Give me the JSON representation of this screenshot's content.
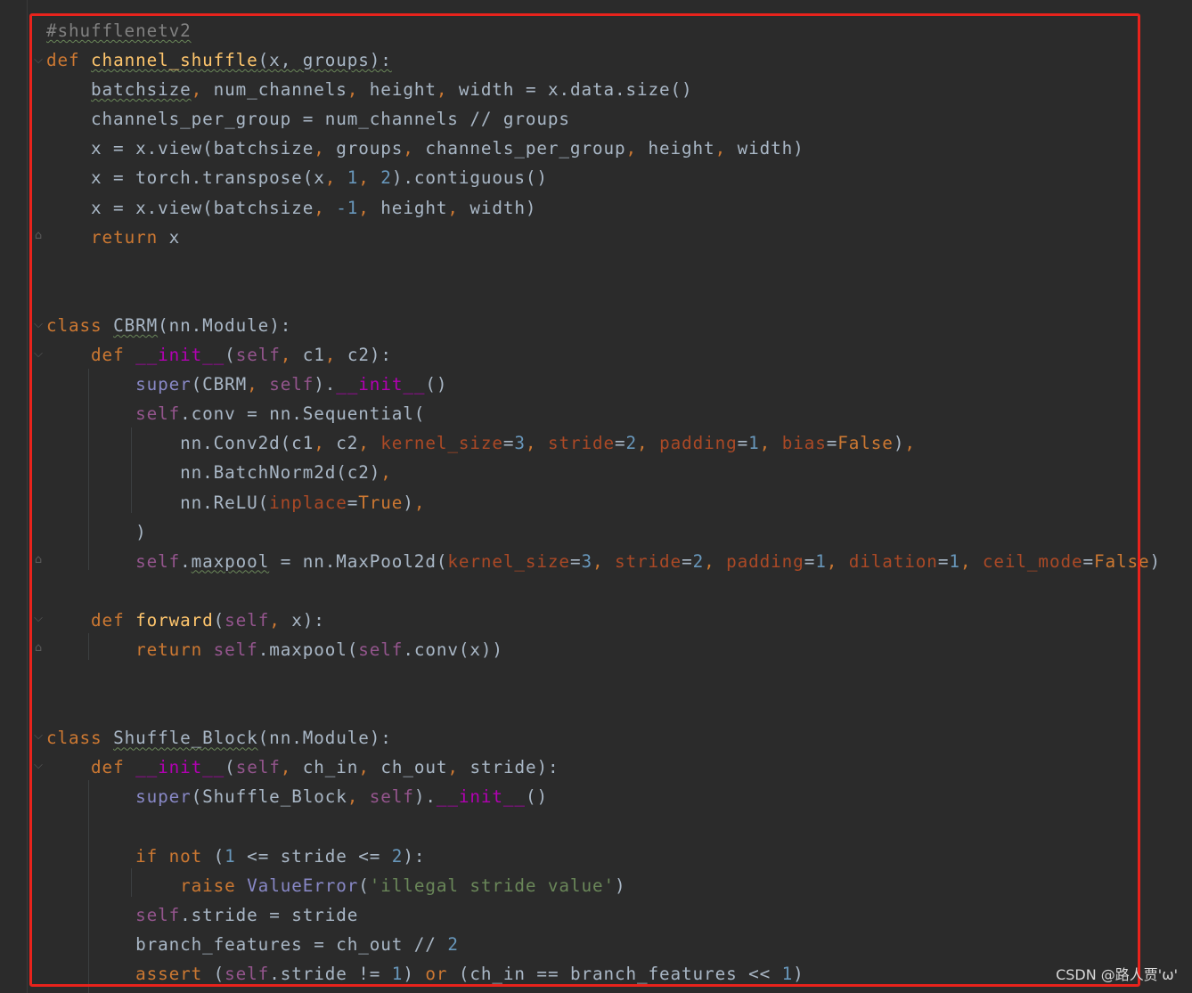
{
  "editor": {
    "lines": [
      [
        {
          "t": "#shufflenetv2",
          "c": "cmt wavy"
        }
      ],
      [
        {
          "t": "def ",
          "c": "kw"
        },
        {
          "t": "channel_shuffle",
          "c": "fn wavy"
        },
        {
          "t": "(x, groups):",
          "c": "wavy"
        }
      ],
      [
        {
          "t": "    "
        },
        {
          "t": "batchsize",
          "c": "wavy"
        },
        {
          "t": ", ",
          "c": "kw"
        },
        {
          "t": "num_channels"
        },
        {
          "t": ", ",
          "c": "kw"
        },
        {
          "t": "height"
        },
        {
          "t": ", ",
          "c": "kw"
        },
        {
          "t": "width = x.data.size()"
        }
      ],
      [
        {
          "t": "    channels_per_group = num_channels // groups"
        }
      ],
      [
        {
          "t": "    x = x.view(batchsize"
        },
        {
          "t": ", ",
          "c": "kw"
        },
        {
          "t": "groups"
        },
        {
          "t": ", ",
          "c": "kw"
        },
        {
          "t": "channels_per_group"
        },
        {
          "t": ", ",
          "c": "kw"
        },
        {
          "t": "height"
        },
        {
          "t": ", ",
          "c": "kw"
        },
        {
          "t": "width)"
        }
      ],
      [
        {
          "t": "    x = torch.transpose(x"
        },
        {
          "t": ", ",
          "c": "kw"
        },
        {
          "t": "1",
          "c": "num"
        },
        {
          "t": ", ",
          "c": "kw"
        },
        {
          "t": "2",
          "c": "num"
        },
        {
          "t": ").contiguous()"
        }
      ],
      [
        {
          "t": "    x = x.view(batchsize"
        },
        {
          "t": ", ",
          "c": "kw"
        },
        {
          "t": "-1",
          "c": "num"
        },
        {
          "t": ", ",
          "c": "kw"
        },
        {
          "t": "height"
        },
        {
          "t": ", ",
          "c": "kw"
        },
        {
          "t": "width)"
        }
      ],
      [
        {
          "t": "    "
        },
        {
          "t": "return ",
          "c": "kw"
        },
        {
          "t": "x"
        }
      ],
      [],
      [],
      [
        {
          "t": "class ",
          "c": "kw"
        },
        {
          "t": "CBRM",
          "c": "wavy"
        },
        {
          "t": "(nn.Module):"
        }
      ],
      [
        {
          "t": "    "
        },
        {
          "t": "def ",
          "c": "kw"
        },
        {
          "t": "__init__",
          "c": "dunder"
        },
        {
          "t": "("
        },
        {
          "t": "self",
          "c": "selfkw"
        },
        {
          "t": ", ",
          "c": "kw"
        },
        {
          "t": "c1"
        },
        {
          "t": ", ",
          "c": "kw"
        },
        {
          "t": "c2):"
        }
      ],
      [
        {
          "t": "        "
        },
        {
          "t": "super",
          "c": "builtin"
        },
        {
          "t": "(CBRM"
        },
        {
          "t": ", ",
          "c": "kw"
        },
        {
          "t": "self",
          "c": "selfkw"
        },
        {
          "t": ")."
        },
        {
          "t": "__init__",
          "c": "dunder"
        },
        {
          "t": "()"
        }
      ],
      [
        {
          "t": "        "
        },
        {
          "t": "self",
          "c": "selfkw"
        },
        {
          "t": ".conv = nn.Sequential("
        }
      ],
      [
        {
          "t": "            nn.Conv2d(c1"
        },
        {
          "t": ", ",
          "c": "kw"
        },
        {
          "t": "c2"
        },
        {
          "t": ", ",
          "c": "kw"
        },
        {
          "t": "kernel_size",
          "c": "param"
        },
        {
          "t": "="
        },
        {
          "t": "3",
          "c": "num"
        },
        {
          "t": ", ",
          "c": "kw"
        },
        {
          "t": "stride",
          "c": "param"
        },
        {
          "t": "="
        },
        {
          "t": "2",
          "c": "num"
        },
        {
          "t": ", ",
          "c": "kw"
        },
        {
          "t": "padding",
          "c": "param"
        },
        {
          "t": "="
        },
        {
          "t": "1",
          "c": "num"
        },
        {
          "t": ", ",
          "c": "kw"
        },
        {
          "t": "bias",
          "c": "param"
        },
        {
          "t": "="
        },
        {
          "t": "False",
          "c": "kw"
        },
        {
          "t": ")"
        },
        {
          "t": ",",
          "c": "kw"
        }
      ],
      [
        {
          "t": "            nn.BatchNorm2d(c2)"
        },
        {
          "t": ",",
          "c": "kw"
        }
      ],
      [
        {
          "t": "            nn.ReLU("
        },
        {
          "t": "inplace",
          "c": "param"
        },
        {
          "t": "="
        },
        {
          "t": "True",
          "c": "kw"
        },
        {
          "t": ")"
        },
        {
          "t": ",",
          "c": "kw"
        }
      ],
      [
        {
          "t": "        )"
        }
      ],
      [
        {
          "t": "        "
        },
        {
          "t": "self",
          "c": "selfkw"
        },
        {
          "t": "."
        },
        {
          "t": "maxpool",
          "c": "wavy"
        },
        {
          "t": " = nn.MaxPool2d("
        },
        {
          "t": "kernel_size",
          "c": "param"
        },
        {
          "t": "="
        },
        {
          "t": "3",
          "c": "num"
        },
        {
          "t": ", ",
          "c": "kw"
        },
        {
          "t": "stride",
          "c": "param"
        },
        {
          "t": "="
        },
        {
          "t": "2",
          "c": "num"
        },
        {
          "t": ", ",
          "c": "kw"
        },
        {
          "t": "padding",
          "c": "param"
        },
        {
          "t": "="
        },
        {
          "t": "1",
          "c": "num"
        },
        {
          "t": ", ",
          "c": "kw"
        },
        {
          "t": "dilation",
          "c": "param"
        },
        {
          "t": "="
        },
        {
          "t": "1",
          "c": "num"
        },
        {
          "t": ", ",
          "c": "kw"
        },
        {
          "t": "ceil_mode",
          "c": "param"
        },
        {
          "t": "="
        },
        {
          "t": "False",
          "c": "kw"
        },
        {
          "t": ")"
        }
      ],
      [],
      [
        {
          "t": "    "
        },
        {
          "t": "def ",
          "c": "kw"
        },
        {
          "t": "forward",
          "c": "fn"
        },
        {
          "t": "("
        },
        {
          "t": "self",
          "c": "selfkw"
        },
        {
          "t": ", ",
          "c": "kw"
        },
        {
          "t": "x):"
        }
      ],
      [
        {
          "t": "        "
        },
        {
          "t": "return ",
          "c": "kw"
        },
        {
          "t": "self",
          "c": "selfkw"
        },
        {
          "t": ".maxpool("
        },
        {
          "t": "self",
          "c": "selfkw"
        },
        {
          "t": ".conv(x))"
        }
      ],
      [],
      [],
      [
        {
          "t": "class ",
          "c": "kw"
        },
        {
          "t": "Shuffle_Block",
          "c": "wavy"
        },
        {
          "t": "(nn.Module):"
        }
      ],
      [
        {
          "t": "    "
        },
        {
          "t": "def ",
          "c": "kw"
        },
        {
          "t": "__init__",
          "c": "dunder"
        },
        {
          "t": "("
        },
        {
          "t": "self",
          "c": "selfkw"
        },
        {
          "t": ", ",
          "c": "kw"
        },
        {
          "t": "ch_in"
        },
        {
          "t": ", ",
          "c": "kw"
        },
        {
          "t": "ch_out"
        },
        {
          "t": ", ",
          "c": "kw"
        },
        {
          "t": "stride):"
        }
      ],
      [
        {
          "t": "        "
        },
        {
          "t": "super",
          "c": "builtin"
        },
        {
          "t": "(Shuffle_Block"
        },
        {
          "t": ", ",
          "c": "kw"
        },
        {
          "t": "self",
          "c": "selfkw"
        },
        {
          "t": ")."
        },
        {
          "t": "__init__",
          "c": "dunder"
        },
        {
          "t": "()"
        }
      ],
      [],
      [
        {
          "t": "        "
        },
        {
          "t": "if not ",
          "c": "kw"
        },
        {
          "t": "("
        },
        {
          "t": "1",
          "c": "num"
        },
        {
          "t": " <= stride <= "
        },
        {
          "t": "2",
          "c": "num"
        },
        {
          "t": "):"
        }
      ],
      [
        {
          "t": "            "
        },
        {
          "t": "raise ",
          "c": "kw"
        },
        {
          "t": "ValueError",
          "c": "builtin"
        },
        {
          "t": "("
        },
        {
          "t": "'illegal stride value'",
          "c": "str"
        },
        {
          "t": ")"
        }
      ],
      [
        {
          "t": "        "
        },
        {
          "t": "self",
          "c": "selfkw"
        },
        {
          "t": ".stride = stride"
        }
      ],
      [
        {
          "t": "        branch_features = ch_out // "
        },
        {
          "t": "2",
          "c": "num"
        }
      ],
      [
        {
          "t": "        "
        },
        {
          "t": "assert ",
          "c": "kw"
        },
        {
          "t": "("
        },
        {
          "t": "self",
          "c": "selfkw"
        },
        {
          "t": ".stride != "
        },
        {
          "t": "1",
          "c": "num"
        },
        {
          "t": ") "
        },
        {
          "t": "or ",
          "c": "kw"
        },
        {
          "t": "(ch_in == branch_features << "
        },
        {
          "t": "1",
          "c": "num"
        },
        {
          "t": ")"
        }
      ]
    ]
  },
  "watermark": "CSDN @路人贾'ω'",
  "colors": {
    "highlight_border": "#e8231c",
    "background": "#2b2b2b"
  }
}
